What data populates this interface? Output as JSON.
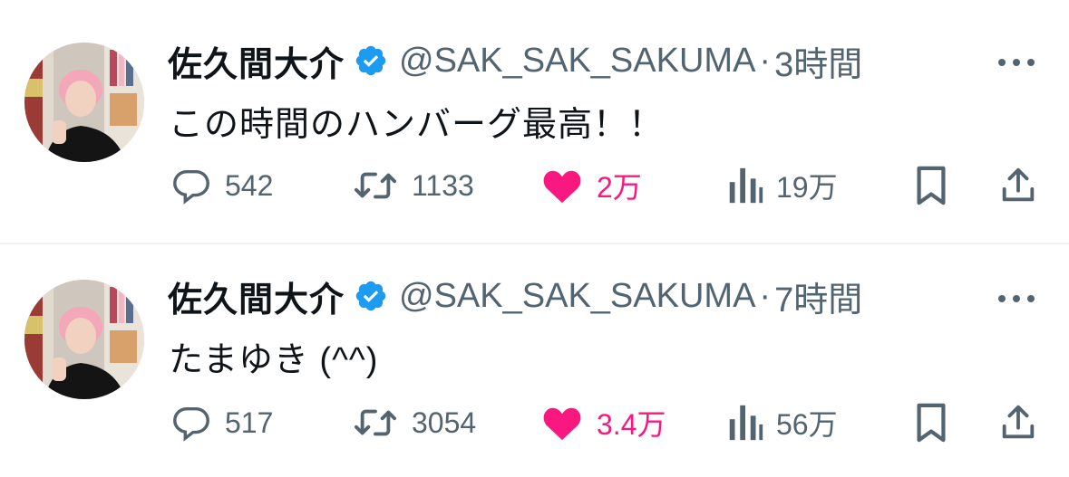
{
  "tweets": [
    {
      "name": "佐久間大介",
      "handle": "@SAK_SAK_SAKUMA",
      "separator": "·",
      "time": "3時間",
      "text": "この時間のハンバーグ最高！！",
      "replies": "542",
      "retweets": "1133",
      "likes": "2万",
      "views": "19万"
    },
    {
      "name": "佐久間大介",
      "handle": "@SAK_SAK_SAKUMA",
      "separator": "·",
      "time": "7時間",
      "text": "たまゆき (^^)",
      "replies": "517",
      "retweets": "3054",
      "likes": "3.4万",
      "views": "56万"
    }
  ],
  "icons": [
    "verified-badge-icon",
    "more-icon",
    "reply-icon",
    "retweet-icon",
    "like-icon",
    "views-icon",
    "bookmark-icon",
    "share-icon"
  ],
  "colors": {
    "like": "#f91880",
    "verified": "#1d9bf0",
    "muted": "#536471",
    "text": "#0f1419"
  }
}
